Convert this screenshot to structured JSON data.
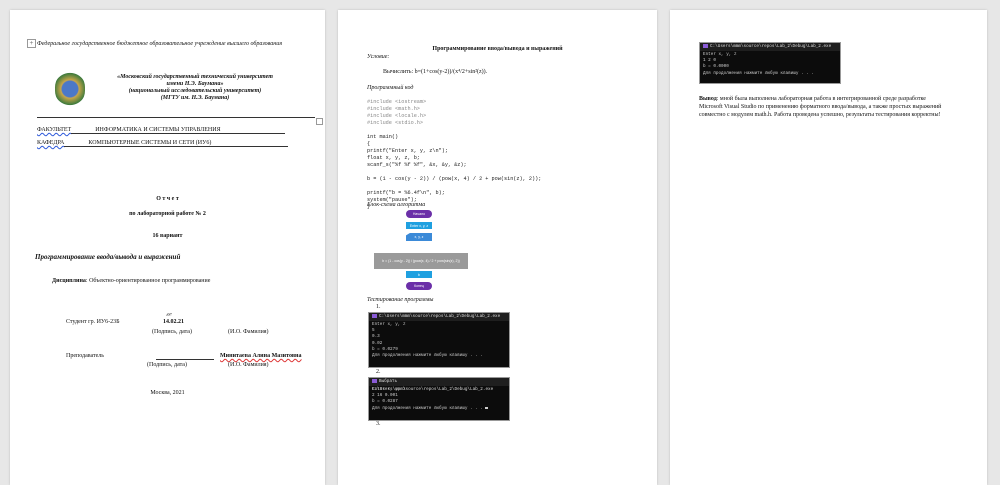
{
  "page1": {
    "header": "Федеральное государственное бюджетное образовательное учреждение высшего образования",
    "university": [
      "«Московский государственный технический университет",
      "имени Н.Э. Баумана»",
      "(национальный исследовательский университет)",
      "(МГТУ им. Н.Э. Баумана)"
    ],
    "faculty_label": "ФАКУЛЬТЕТ",
    "faculty": "ИНФОРМАТИКА И СИСТЕМЫ УПРАВЛЕНИЯ",
    "dept_label": "КАФЕДРА",
    "dept": "КОМПЬЮТЕРНЫЕ СИСТЕМЫ И СЕТИ (ИУ6)",
    "report": "О т ч е т",
    "lab": "по лабораторной работе № 2",
    "variant": "16 вариант",
    "topic": "Программирование ввода/вывода и выражений",
    "discipline_label": "Дисциплина",
    "discipline": ": Объектно-ориентированное программирование",
    "student": "Студент   гр.   ИУ6-23Б",
    "student_date": "14.02.21",
    "sign_caption": "(Подпись, дата)",
    "name_caption": "(И.О. Фамилия)",
    "teacher": "Преподаватель",
    "teacher_name": "Минитаева Алина Мазитовна",
    "city": "Москва, 2021"
  },
  "page2": {
    "title": "Программирование ввода/вывода и выражений",
    "condition_label": "Условие:",
    "condition": "Вычислить: b=(1+cos(y-2))/(x⁴/2+sin²(z)).",
    "code_label": "Программный код",
    "code": [
      "#include <iostream>",
      "#include <math.h>",
      "#include <locale.h>",
      "#include <stdio.h>",
      "",
      "int main()",
      "{",
      "    printf(\"Enter x, y, z\\n\");",
      "    float x, y, z, b;",
      "    scanf_s(\"%f %f %f\", &x, &y, &z);",
      "",
      "    b = (1 - cos(y - 2)) / (pow(x, 4) / 2 + pow(sin(z), 2));",
      "",
      "    printf(\"b = %6.4f\\n\", b);",
      "    system(\"pause\");",
      "}"
    ],
    "flow_label": "Блок-схема алгоритма",
    "flow": {
      "start": "Начало",
      "prompt": "Enter x, y, z",
      "input": "x, y, z",
      "calc": "b = (1 - cos(y - 2)) / (pow(x, 4) / 2 + pow(sin(z), 2))",
      "output": "b",
      "end": "Конец"
    },
    "test_label": "Тестирование программы",
    "tests": [
      {
        "num": "1.",
        "title": "C:\\Users\\mmm\\source\\repos\\Lab_2\\Debug\\Lab_2.exe",
        "lines": [
          "Enter x, y, z",
          "5",
          "0.3",
          "0.02",
          "b = 0.0279",
          "Для продолжения нажмите любую клавишу . . ."
        ]
      },
      {
        "num": "2.",
        "title": "Выбрать C:\\Users\\mmm\\source\\repos\\Lab_2\\Debug\\Lab_2.exe",
        "lines": [
          "Enter x, y, z",
          "2 16 0.001",
          "b = 0.0287",
          "Для продолжения нажмите любую клавишу . . ."
        ]
      }
    ],
    "num3": "3."
  },
  "page3": {
    "console": {
      "title": "C:\\Users\\mmm\\source\\repos\\Lab_2\\Debug\\Lab_2.exe",
      "lines": [
        "Enter x, y, z",
        "1 2 0",
        "b = 0.0000",
        "Для продолжения нажмите любую клавишу . . ."
      ]
    },
    "conclusion_label": "Вывод",
    "conclusion": [
      ": мной была выполнена лабораторная работа в интегрированной среде разработке",
      "Microsoft Visual Studio по применению форматного ввода/вывода, а также простых выражений",
      "совместно с модулем math.h. Работа проведена успешно, результаты тестирования корректны!"
    ]
  }
}
